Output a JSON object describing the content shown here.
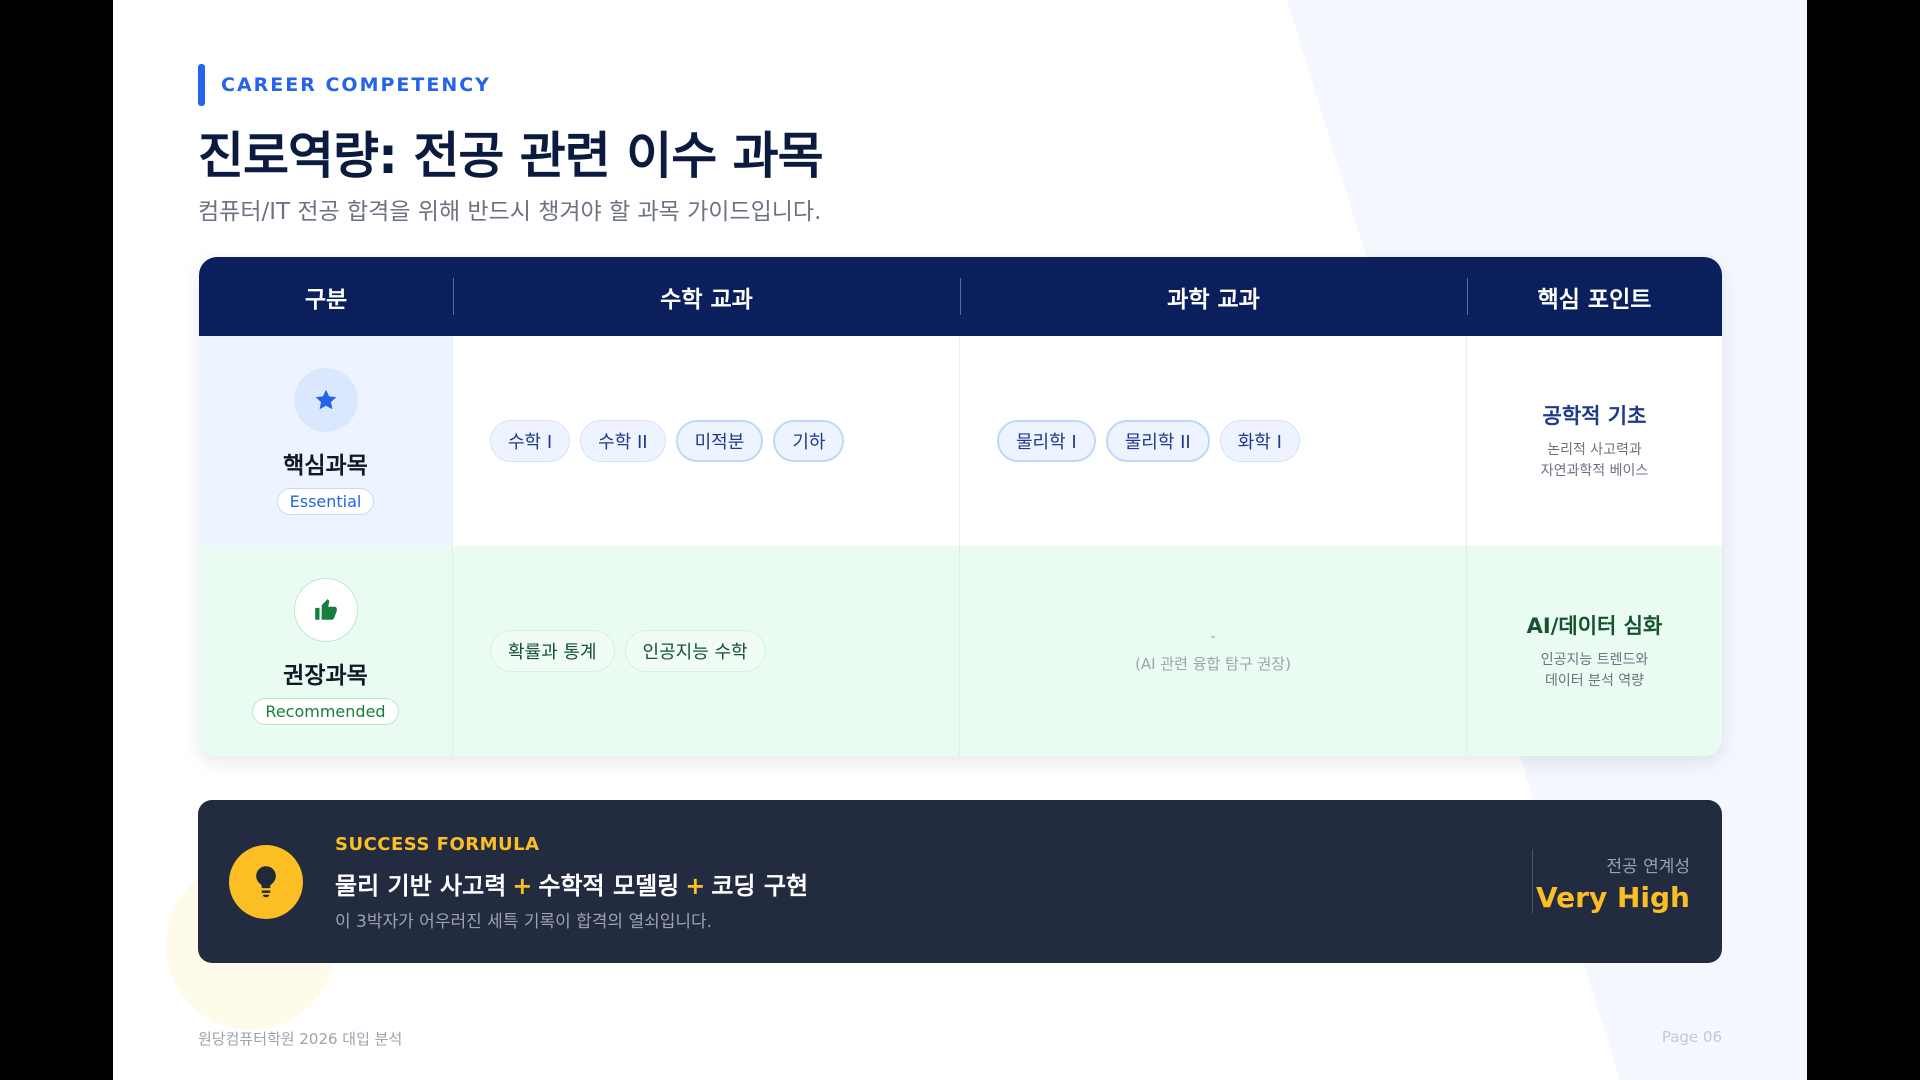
{
  "colors": {
    "accent": "#2563eb",
    "header_navy": "#0a1f5c",
    "formula_bg": "#222b3f",
    "highlight_yellow": "#fbbf24",
    "green": "#15803d"
  },
  "header": {
    "eyebrow": "CAREER COMPETENCY",
    "title": "진로역량: 전공 관련 이수 과목",
    "subtitle": "컴퓨터/IT 전공 합격을 위해 반드시 챙겨야 할 과목 가이드입니다."
  },
  "table": {
    "columns": [
      "구분",
      "수학 교과",
      "과학 교과",
      "핵심 포인트"
    ],
    "rows": [
      {
        "icon": "star-icon",
        "category": "핵심과목",
        "tag": "Essential",
        "math": [
          "수학 I",
          "수학 II",
          "미적분",
          "기하"
        ],
        "science": [
          "물리학 I",
          "물리학 II",
          "화학 I"
        ],
        "point_title": "공학적 기초",
        "point_desc_1": "논리적 사고력과",
        "point_desc_2": "자연과학적 베이스"
      },
      {
        "icon": "thumbs-up-icon",
        "category": "권장과목",
        "tag": "Recommended",
        "math": [
          "확률과 통계",
          "인공지능 수학"
        ],
        "science_dash": "-",
        "science_note": "(AI 관련 융합 탐구 권장)",
        "point_title": "AI/데이터 심화",
        "point_desc_1": "인공지능 트렌드와",
        "point_desc_2": "데이터 분석 역량"
      }
    ]
  },
  "formula": {
    "icon": "lightbulb-icon",
    "label": "SUCCESS FORMULA",
    "part1": "물리 기반 사고력",
    "plus": "+",
    "part2": "수학적 모델링",
    "part3": "코딩 구현",
    "subtext": "이 3박자가 어우러진 세특 기록이 합격의 열쇠입니다.",
    "right_label": "전공 연계성",
    "right_value": "Very High"
  },
  "footer": {
    "left": "원당컴퓨터학원 2026 대입 분석",
    "right": "Page 06"
  }
}
